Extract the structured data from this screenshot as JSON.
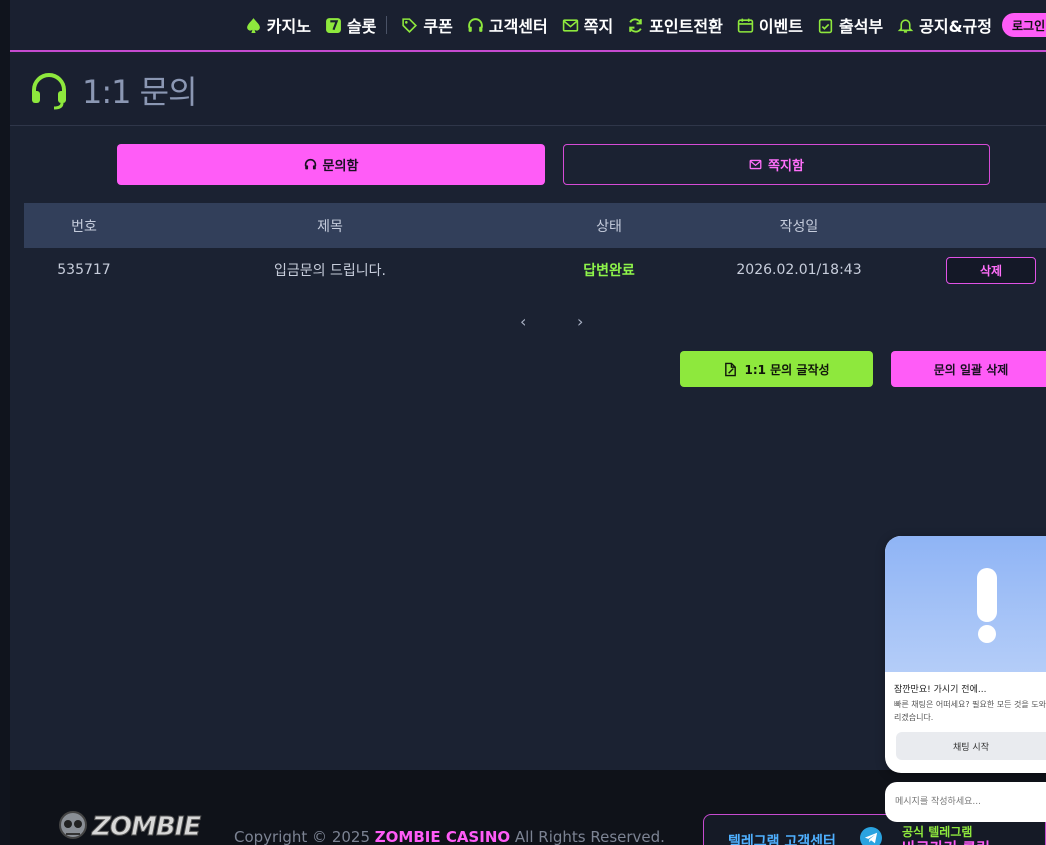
{
  "nav": {
    "items": [
      {
        "label": "카지노",
        "icon": "spade-icon"
      },
      {
        "label": "슬롯",
        "icon": "slot-seven-icon"
      },
      {
        "label": "쿠폰",
        "icon": "tag-icon"
      },
      {
        "label": "고객센터",
        "icon": "headset-icon"
      },
      {
        "label": "쪽지",
        "icon": "mail-icon"
      },
      {
        "label": "포인트전환",
        "icon": "refresh-icon"
      },
      {
        "label": "이벤트",
        "icon": "calendar-icon"
      },
      {
        "label": "출석부",
        "icon": "clipboard-check-icon"
      },
      {
        "label": "공지&규정",
        "icon": "bell-icon"
      }
    ],
    "login_label": "로그인",
    "accent": "#ff5cf7",
    "icon_color": "#8ee83d"
  },
  "page": {
    "title": "1:1 문의"
  },
  "tabs": [
    {
      "label": "문의함",
      "active": true
    },
    {
      "label": "쪽지함",
      "active": false
    }
  ],
  "table": {
    "headers": [
      "번호",
      "제목",
      "상태",
      "작성일"
    ],
    "rows": [
      {
        "id": "535717",
        "title": "입금문의 드립니다.",
        "status": "답변완료",
        "date": "2026.02.01/18:43",
        "delete_label": "삭제"
      }
    ]
  },
  "pagination": {
    "prev": "‹",
    "next": "›"
  },
  "actions": {
    "write_label": "1:1 문의 글작성",
    "delete_all_label": "문의 일괄 삭제"
  },
  "footer": {
    "logo_text": "ZOMBIE",
    "copyright_prefix": "Copyright © 2025 ",
    "brand": "ZOMBIE CASINO",
    "copyright_suffix": " All Rights Reserved.",
    "telegram_center": "텔레그램 고객센터",
    "telegram_official": "공식 텔레그램",
    "telegram_click": "바로가기 클릭"
  },
  "chat": {
    "title": "잠깐만요! 가시기 전에...",
    "desc": "빠른 채팅은 어떠세요? 필요한 모든 것을 도와드리겠습니다.",
    "start_label": "채팅 시작",
    "input_placeholder": "메시지를 작성하세요..."
  }
}
